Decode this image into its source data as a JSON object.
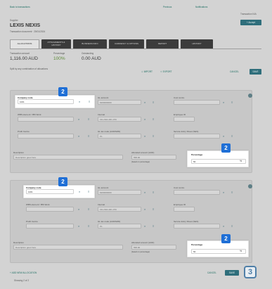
{
  "top": {
    "back_link": "Back to transactions",
    "nav_previous": "Previous",
    "nav_next": "Notifications",
    "transaction_label": "Transaction N/A",
    "add_button": "+ Accept"
  },
  "header": {
    "supplier_caption": "Supplier",
    "title": "LEXIS NEXIS",
    "subtitle": "Transaction document · 25/01/2024"
  },
  "tabs": [
    {
      "label": "ALLOCATIONS",
      "active": true
    },
    {
      "label": "ATTACHMENTS & HISTORY",
      "active": false
    },
    {
      "label": "BUSINESS INFO",
      "active": false
    },
    {
      "label": "CURRENCY & OPTIONS",
      "active": false
    },
    {
      "label": "REPORT",
      "active": false
    },
    {
      "label": "HISTORY",
      "active": false
    }
  ],
  "summary": {
    "amount_label": "Transaction amount",
    "amount_value": "1,116.00 AUD",
    "percent_label": "Percentage",
    "percent_value": "100%",
    "remaining_label": "Outstanding",
    "remaining_value": "0.00 AUD",
    "note": "Split by any combination of allocations"
  },
  "actions": {
    "import": "IMPORT",
    "export": "EXPORT",
    "cancel": "CANCEL",
    "save": "SAVE"
  },
  "allocations": [
    {
      "company_label": "Company code",
      "company_value": "1001",
      "gl_account_label": "GL account",
      "gl_account_value": "6200000000",
      "cost_centre_label": "Cost centre",
      "cost_centre_value": "",
      "wbs_label": "WBS element / IBS Work",
      "wbs_value": "",
      "internal_label": "Internal",
      "internal_value": "KD-2024-001-070",
      "employee_label": "Employee ID",
      "employee_value": "",
      "profit_label": "Profit Centre",
      "profit_value": "",
      "tax_label": "GL tax code (AUD/NZD)",
      "tax_value": "P1",
      "service_label": "Service Entry Sheet (SES)",
      "service_value": "",
      "description_label": "Description",
      "description_value": "Description goes here",
      "amount_label": "Allocated amount (AUD)",
      "amount_value": "558.00",
      "amount_hint": "(based on percentage)",
      "percentage_label": "Percentage",
      "percentage_value": "50",
      "badge_company": "2",
      "badge_percentage": "2"
    },
    {
      "company_label": "Company code",
      "company_value": "1001",
      "gl_account_label": "GL account",
      "gl_account_value": "6200000000",
      "cost_centre_label": "Cost centre",
      "cost_centre_value": "",
      "wbs_label": "WBS element / IBS Work",
      "wbs_value": "",
      "internal_label": "Internal",
      "internal_value": "KD-2024-001-070",
      "employee_label": "Employee ID",
      "employee_value": "",
      "profit_label": "Profit Centre",
      "profit_value": "",
      "tax_label": "GL tax code (AUD/NZD)",
      "tax_value": "P1",
      "service_label": "Service Entry Sheet (SES)",
      "service_value": "",
      "description_label": "Description",
      "description_value": "Description goes here",
      "amount_label": "Allocated amount (AUD)",
      "amount_value": "558.00",
      "amount_hint": "(based on percentage)",
      "percentage_label": "Percentage",
      "percentage_value": "50",
      "badge_company": "2",
      "badge_percentage": "2"
    }
  ],
  "footer": {
    "add_allocation": "+ ADD NEW ALLOCATION",
    "showing": "Showing 2 of 2",
    "cancel": "CANCEL",
    "save": "SAVE",
    "step_badge": "3"
  },
  "colors": {
    "accent_teal": "#2f6e7b",
    "badge_blue": "#1f6fd6",
    "step_outline": "#4f7fa8"
  }
}
